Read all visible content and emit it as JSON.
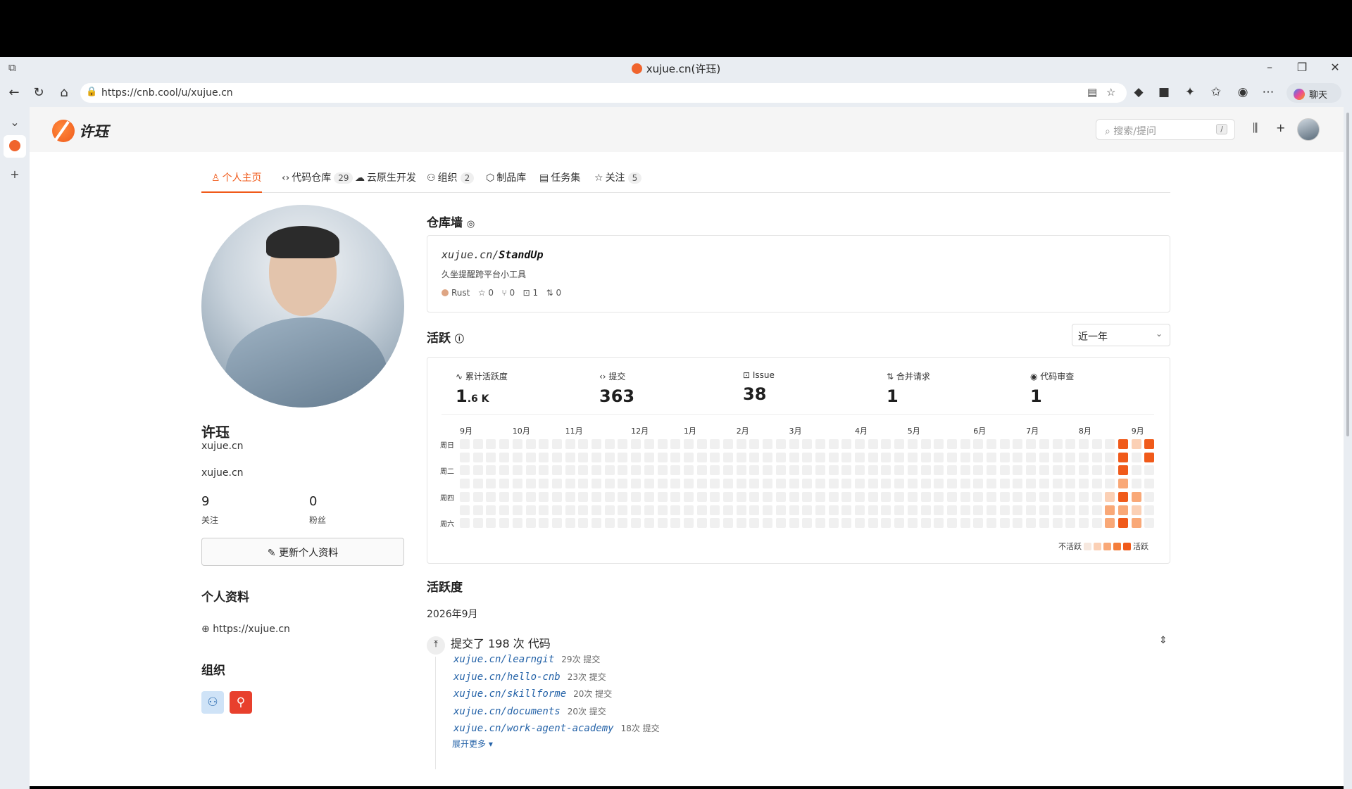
{
  "browser": {
    "tab_title": "xujue.cn(许珏)",
    "url": "https://cnb.cool/u/xujue.cn",
    "chat_label": "聊天"
  },
  "site": {
    "logo_text": "许珏",
    "search_placeholder": "搜索/提问",
    "search_shortcut": "/"
  },
  "tabs": [
    {
      "label": "个人主页",
      "count": ""
    },
    {
      "label": "代码仓库",
      "count": "29"
    },
    {
      "label": "云原生开发",
      "count": ""
    },
    {
      "label": "组织",
      "count": "2"
    },
    {
      "label": "制品库",
      "count": ""
    },
    {
      "label": "任务集",
      "count": ""
    },
    {
      "label": "关注",
      "count": "5"
    }
  ],
  "profile": {
    "name": "许珏",
    "username": "xujue.cn",
    "bio": "xujue.cn",
    "following_count": "9",
    "following_label": "关注",
    "followers_count": "0",
    "followers_label": "粉丝",
    "edit_button": "更新个人资料",
    "info_title": "个人资料",
    "website": "https://xujue.cn",
    "org_title": "组织"
  },
  "repo_wall": {
    "title": "仓库墙",
    "repo_owner": "xujue.cn/",
    "repo_name": "StandUp",
    "description": "久坐提醒跨平台小工具",
    "language": "Rust",
    "language_color": "#dea584",
    "stars": "0",
    "forks": "0",
    "issues": "1",
    "pulls": "0"
  },
  "activity": {
    "title": "活跃",
    "range": "近一年",
    "stats": [
      {
        "label": "累计活跃度",
        "value": "1",
        "suffix": ".6 K"
      },
      {
        "label": "提交",
        "value": "363",
        "suffix": ""
      },
      {
        "label": "Issue",
        "value": "38",
        "suffix": ""
      },
      {
        "label": "合并请求",
        "value": "1",
        "suffix": ""
      },
      {
        "label": "代码审查",
        "value": "1",
        "suffix": ""
      }
    ],
    "months": [
      "9月",
      "10月",
      "11月",
      "12月",
      "1月",
      "2月",
      "3月",
      "4月",
      "5月",
      "6月",
      "7月",
      "8月",
      "9月"
    ],
    "days": [
      "周日",
      "周二",
      "周四",
      "周六"
    ],
    "legend_less": "不活跃",
    "legend_more": "活跃",
    "accent": "#f05a1a"
  },
  "timeline": {
    "title": "活跃度",
    "month": "2026年9月",
    "summary": "提交了 198 次 代码",
    "repos": [
      {
        "name": "xujue.cn/learngit",
        "count": "29次 提交"
      },
      {
        "name": "xujue.cn/hello-cnb",
        "count": "23次 提交"
      },
      {
        "name": "xujue.cn/skillforme",
        "count": "20次 提交"
      },
      {
        "name": "xujue.cn/documents",
        "count": "20次 提交"
      },
      {
        "name": "xujue.cn/work-agent-academy",
        "count": "18次 提交"
      }
    ],
    "expand": "展开更多 ▾"
  }
}
